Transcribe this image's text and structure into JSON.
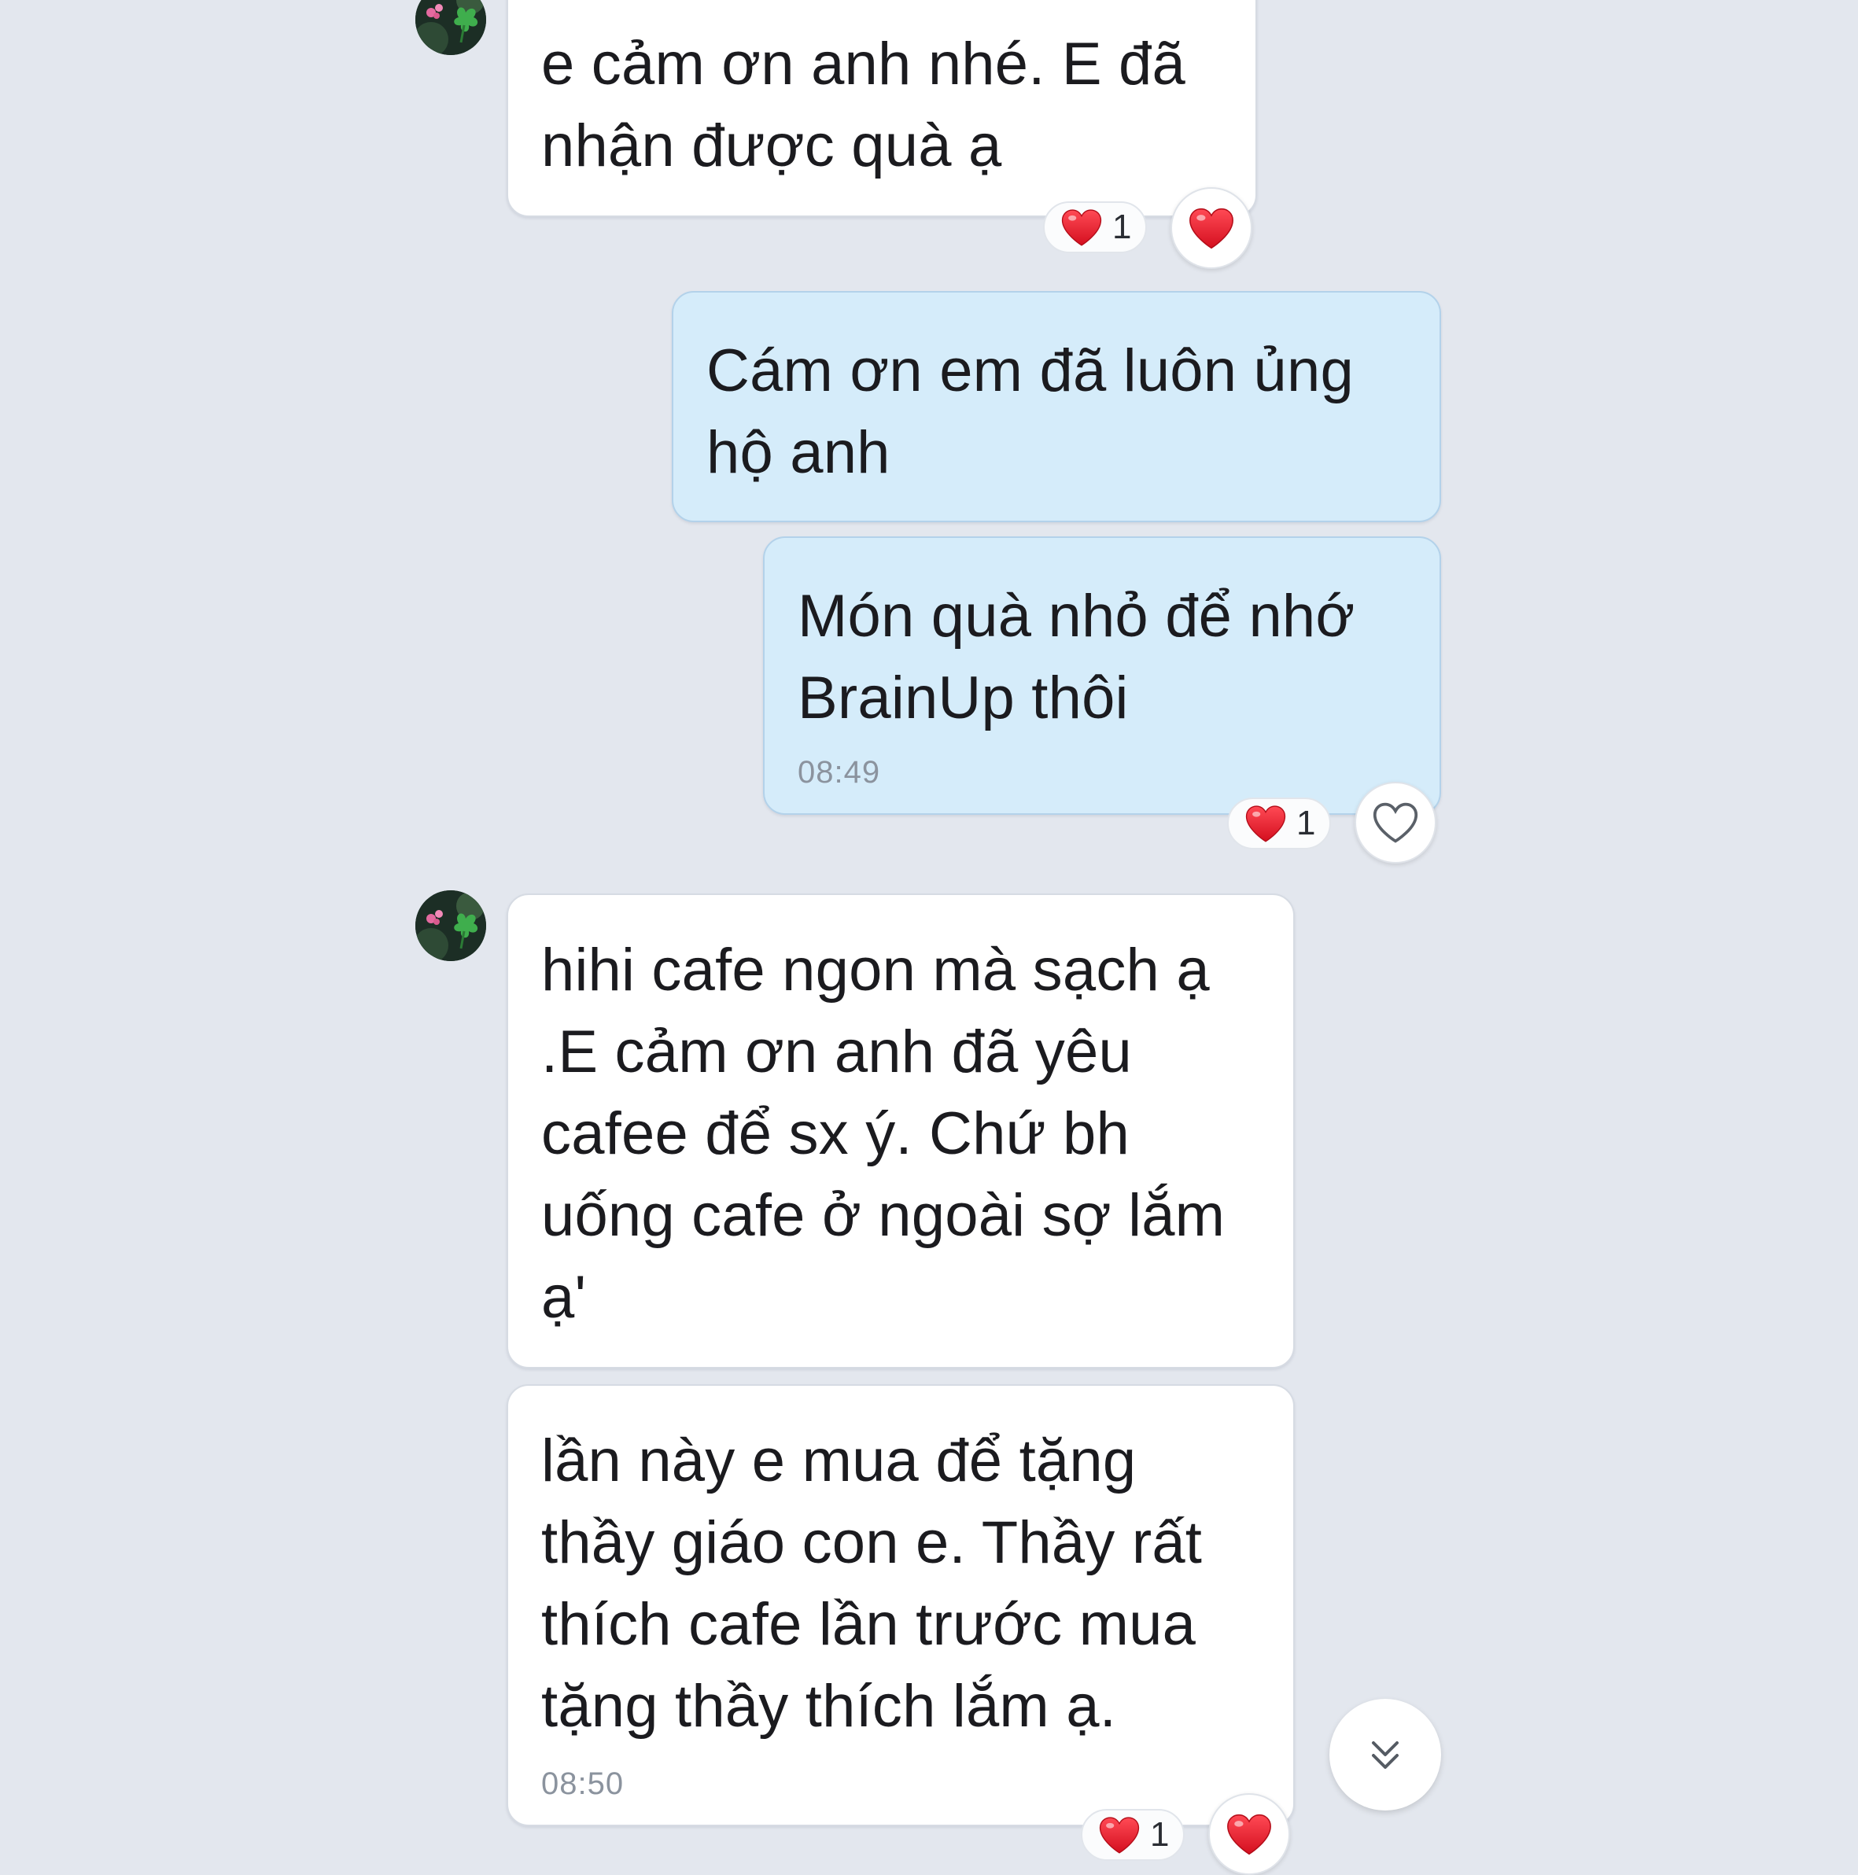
{
  "colors": {
    "background": "#e3e7ee",
    "incoming_bubble": "#ffffff",
    "outgoing_bubble": "#d5ecfa",
    "heart": "#e8202e",
    "timestamp": "#8b939e"
  },
  "messages": [
    {
      "sender": "contact",
      "text": "e cảm ơn anh nhé. E đã\nnhận được quà ạ",
      "reaction": {
        "icon": "heart-icon",
        "count": "1"
      }
    },
    {
      "sender": "me",
      "text": "Cám ơn em đã luôn ủng\nhộ anh"
    },
    {
      "sender": "me",
      "text": "Món quà nhỏ để nhớ\nBrainUp thôi",
      "time": "08:49",
      "reaction": {
        "icon": "heart-icon",
        "count": "1"
      }
    },
    {
      "sender": "contact",
      "text": "hihi cafe ngon mà sạch ạ\n.E cảm ơn anh đã yêu\ncafee để sx ý. Chứ bh\nuống cafe ở ngoài sợ lắm\nạ'"
    },
    {
      "sender": "contact",
      "text": "lần này e mua để tặng\nthầy giáo con e. Thầy rất\nthích cafe lần trước mua\ntặng thầy thích lắm ạ.",
      "time": "08:50",
      "reaction": {
        "icon": "heart-icon",
        "count": "1"
      }
    }
  ],
  "scroll_button": {
    "icon": "chevrons-down-icon"
  }
}
